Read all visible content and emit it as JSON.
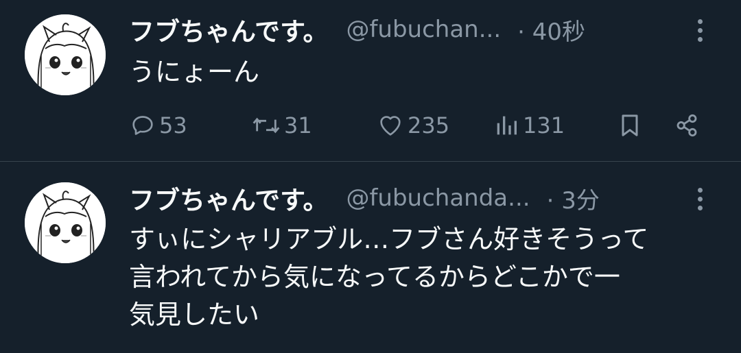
{
  "tweets": [
    {
      "display_name": "フブちゃんです。",
      "handle": "@fubuchan...",
      "time": "· 40秒",
      "text": "うにょーん",
      "actions": {
        "replies": "53",
        "retweets": "31",
        "likes": "235",
        "views": "131"
      },
      "avatar_icon": "cartoon-avatar-icon"
    },
    {
      "display_name": "フブちゃんです。",
      "handle": "@fubuchanda...",
      "time": "· 3分",
      "text": "すぃにシャリアブル…フブさん好きそうって\n言われてから気になってるからどこかで一\n気見したい",
      "avatar_icon": "cartoon-avatar-icon"
    }
  ],
  "icons": {
    "reply": "reply-icon",
    "retweet": "retweet-icon",
    "like": "heart-icon",
    "views": "views-icon",
    "bookmark": "bookmark-icon",
    "share": "share-icon",
    "more": "more-vertical-icon"
  },
  "colors": {
    "background": "#15202b",
    "text": "#f7f9f9",
    "secondary": "#8b98a5",
    "divider": "#38444d"
  }
}
